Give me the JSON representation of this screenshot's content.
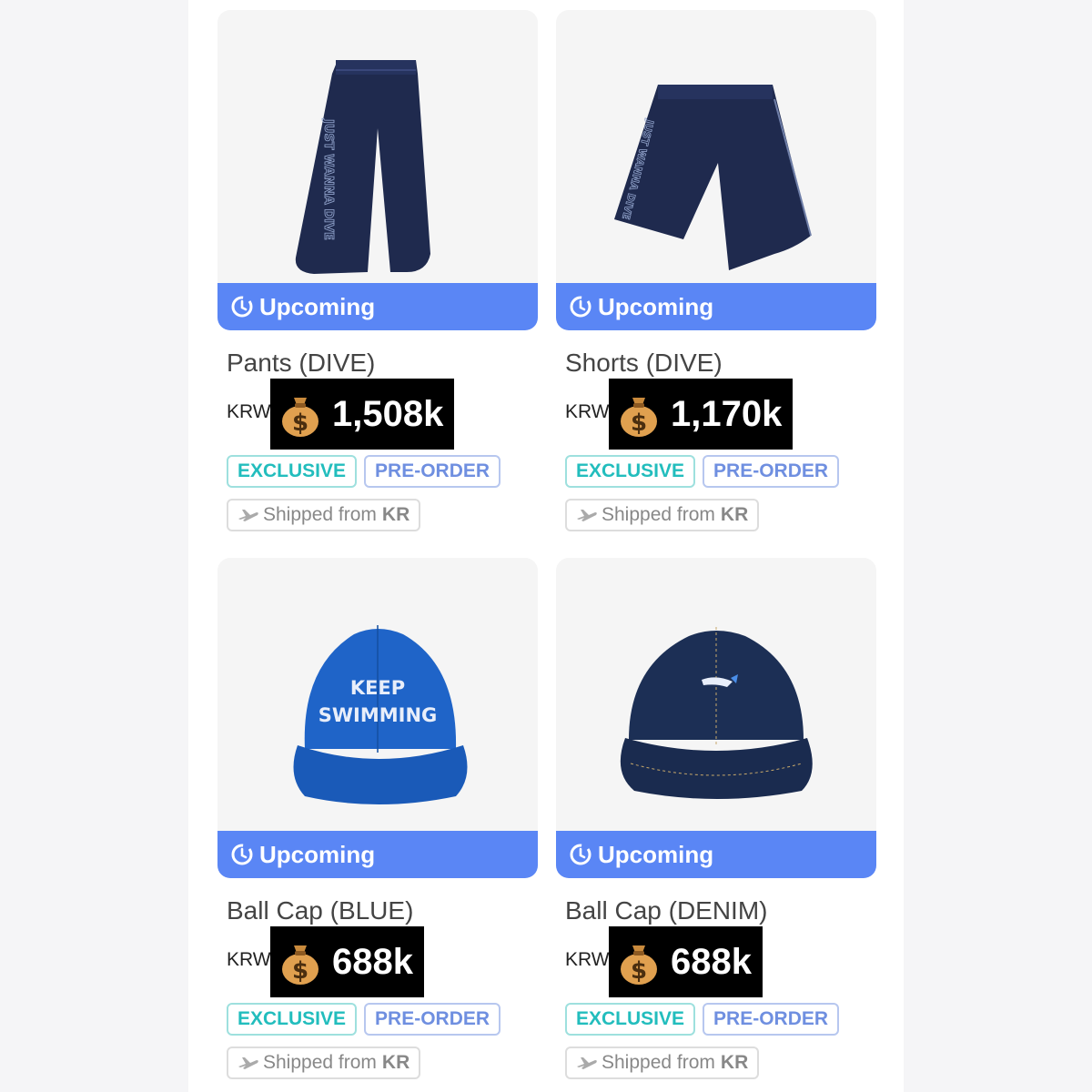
{
  "colors": {
    "status_bar": "#5a86f5",
    "exclusive": "#22bdbd",
    "preorder": "#6f8fe0",
    "price_bg": "#000000"
  },
  "products": [
    {
      "name": "Pants (DIVE)",
      "status": "Upcoming",
      "currency": "KRW",
      "price": "1,508k",
      "tags": [
        "EXCLUSIVE",
        "PRE-ORDER"
      ],
      "ship_label": "Shipped from",
      "ship_country": "KR",
      "image_text": "JUST WANNA DIVE"
    },
    {
      "name": "Shorts (DIVE)",
      "status": "Upcoming",
      "currency": "KRW",
      "price": "1,170k",
      "tags": [
        "EXCLUSIVE",
        "PRE-ORDER"
      ],
      "ship_label": "Shipped from",
      "ship_country": "KR",
      "image_text": "JUST WANNA DIVE"
    },
    {
      "name": "Ball Cap (BLUE)",
      "status": "Upcoming",
      "currency": "KRW",
      "price": "688k",
      "tags": [
        "EXCLUSIVE",
        "PRE-ORDER"
      ],
      "ship_label": "Shipped from",
      "ship_country": "KR",
      "image_text_line1": "KEEP",
      "image_text_line2": "SWIMMING"
    },
    {
      "name": "Ball Cap (DENIM)",
      "status": "Upcoming",
      "currency": "KRW",
      "price": "688k",
      "tags": [
        "EXCLUSIVE",
        "PRE-ORDER"
      ],
      "ship_label": "Shipped from",
      "ship_country": "KR"
    }
  ],
  "icons": {
    "status": "clock-icon",
    "price": "money-bag-icon",
    "shipping": "airplane-icon"
  }
}
